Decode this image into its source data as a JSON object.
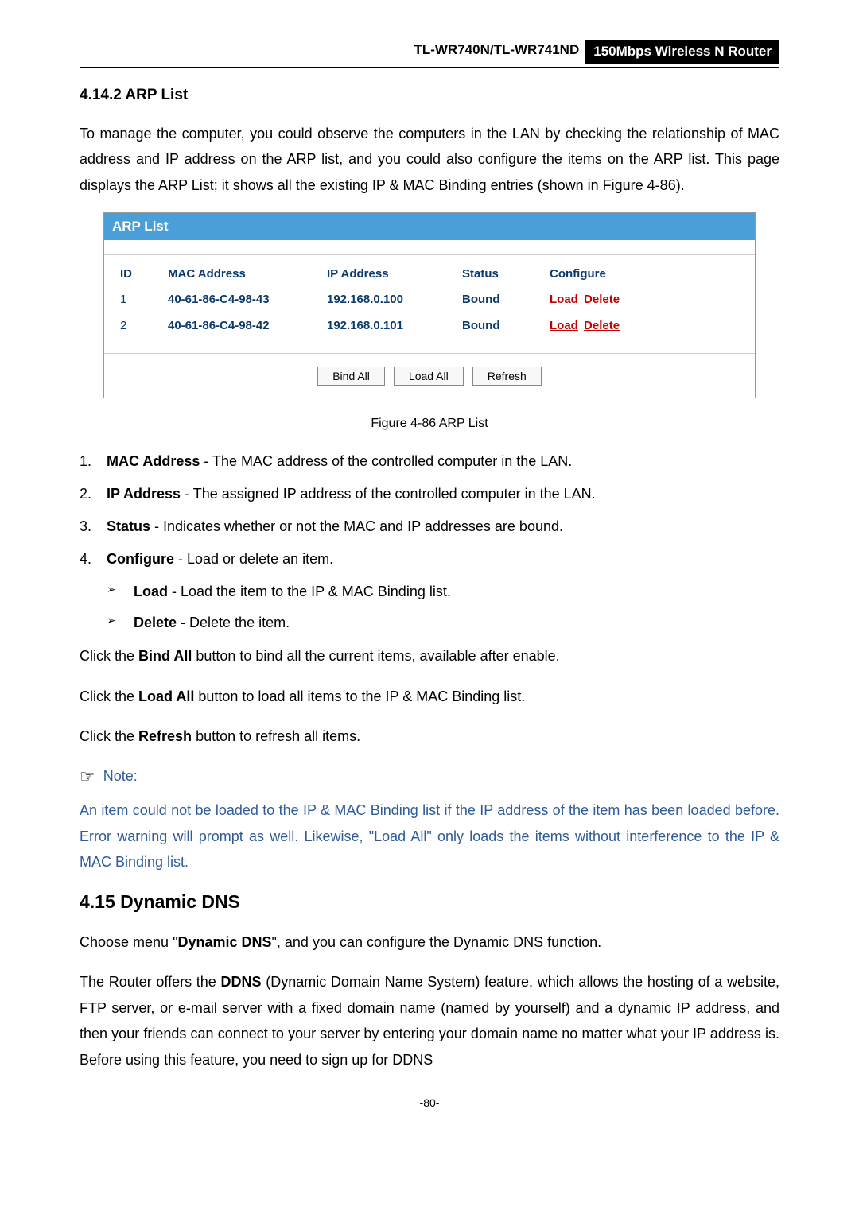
{
  "header": {
    "left": "TL-WR740N/TL-WR741ND",
    "right": "150Mbps Wireless N Router"
  },
  "section_heading": "4.14.2  ARP List",
  "intro_text": "To manage the computer, you could observe the computers in the LAN by checking the relationship of MAC address and IP address on the ARP list, and you could also configure the items on the ARP list. This page displays the ARP List; it shows all the existing IP & MAC Binding entries (shown in Figure 4-86).",
  "arp_title": "ARP List",
  "arp_headers": {
    "id": "ID",
    "mac": "MAC Address",
    "ip": "IP Address",
    "status": "Status",
    "config": "Configure"
  },
  "arp_rows": [
    {
      "id": "1",
      "mac": "40-61-86-C4-98-43",
      "ip": "192.168.0.100",
      "status": "Bound",
      "load": "Load",
      "delete": "Delete"
    },
    {
      "id": "2",
      "mac": "40-61-86-C4-98-42",
      "ip": "192.168.0.101",
      "status": "Bound",
      "load": "Load",
      "delete": "Delete"
    }
  ],
  "buttons": {
    "bind_all": "Bind All",
    "load_all": "Load All",
    "refresh": "Refresh"
  },
  "figure_caption": "Figure 4-86    ARP List",
  "list": [
    {
      "num": "1.",
      "bold": "MAC Address",
      "text": " - The MAC address of the controlled computer in the LAN."
    },
    {
      "num": "2.",
      "bold": "IP Address",
      "text": " - The assigned IP address of the controlled computer in the LAN."
    },
    {
      "num": "3.",
      "bold": "Status",
      "text": " - Indicates whether or not the MAC and IP addresses are bound."
    },
    {
      "num": "4.",
      "bold": "Configure",
      "text": " - Load or delete an item."
    }
  ],
  "sublist": [
    {
      "bold": "Load",
      "text": " - Load the item to the IP & MAC Binding list."
    },
    {
      "bold": "Delete",
      "text": " - Delete the item."
    }
  ],
  "click_lines": {
    "l1_pre": "Click the ",
    "l1_bold": "Bind All",
    "l1_post": " button to bind all the current items, available after enable.",
    "l2_pre": "Click the ",
    "l2_bold": "Load All",
    "l2_post": " button to load all items to the IP & MAC Binding list.",
    "l3_pre": "Click the ",
    "l3_bold": "Refresh",
    "l3_post": " button to refresh all items."
  },
  "note_icon": "☞",
  "note_label": "Note:",
  "note_text": "An item could not be loaded to the IP & MAC Binding list if the IP address of the item has been loaded before. Error warning will prompt as well. Likewise, \"Load All\" only loads the items without interference to the IP & MAC Binding list.",
  "main_heading": "4.15  Dynamic DNS",
  "ddns_p1_pre": "Choose menu \"",
  "ddns_p1_bold": "Dynamic DNS",
  "ddns_p1_post": "\", and you can configure the Dynamic DNS function.",
  "ddns_p2_pre": "The Router offers the ",
  "ddns_p2_bold": "DDNS",
  "ddns_p2_post": " (Dynamic Domain Name System) feature, which allows the hosting of a website, FTP server, or e-mail server with a fixed domain name (named by yourself) and a dynamic IP address, and then your friends can connect to your server by entering your domain name no matter what your IP address is. Before using this feature, you need to sign up for DDNS",
  "page_number": "-80-"
}
